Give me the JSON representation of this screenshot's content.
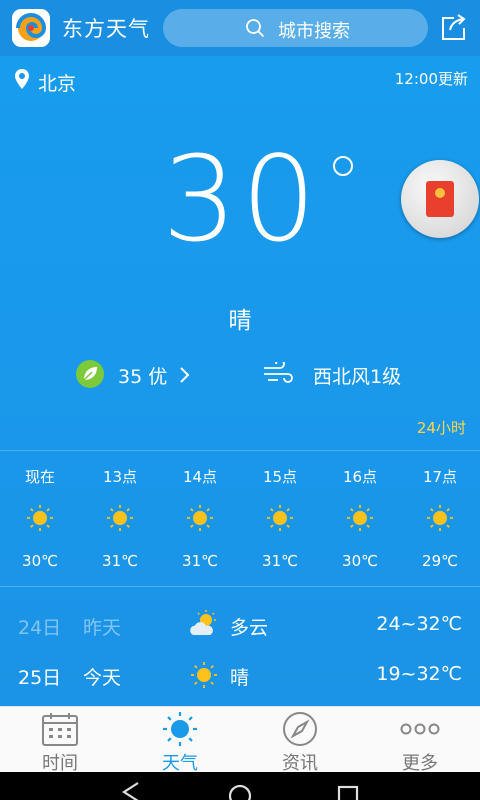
{
  "header": {
    "app_name": "东方天气",
    "search_placeholder": "城市搜索"
  },
  "location": {
    "city": "北京",
    "update_time": "12:00更新"
  },
  "current": {
    "temperature": "30",
    "condition": "晴",
    "aqi": "35 优",
    "wind": "西北风1级"
  },
  "hourly": {
    "link_label": "24小时",
    "items": [
      {
        "label": "现在",
        "temp": "30℃",
        "icon": "sun-icon"
      },
      {
        "label": "13点",
        "temp": "31℃",
        "icon": "sun-icon"
      },
      {
        "label": "14点",
        "temp": "31℃",
        "icon": "sun-icon"
      },
      {
        "label": "15点",
        "temp": "31℃",
        "icon": "sun-icon"
      },
      {
        "label": "16点",
        "temp": "30℃",
        "icon": "sun-icon"
      },
      {
        "label": "17点",
        "temp": "29℃",
        "icon": "sun-icon"
      }
    ]
  },
  "daily": [
    {
      "date": "24日",
      "day": "昨天",
      "condition": "多云",
      "range": "24~32℃",
      "icon": "partly-cloudy-icon"
    },
    {
      "date": "25日",
      "day": "今天",
      "condition": "晴",
      "range": "19~32℃",
      "icon": "sun-icon"
    }
  ],
  "tabs": [
    {
      "label": "时间",
      "icon": "calendar-icon"
    },
    {
      "label": "天气",
      "icon": "sun-icon"
    },
    {
      "label": "资讯",
      "icon": "compass-icon"
    },
    {
      "label": "更多",
      "icon": "more-dots-icon"
    }
  ],
  "colors": {
    "background": "#1b93e8",
    "accent_yellow": "#ffd84a",
    "sun": "#ffc21a",
    "aqi_good": "#7cc93a",
    "active_tab": "#1a9ae8"
  }
}
